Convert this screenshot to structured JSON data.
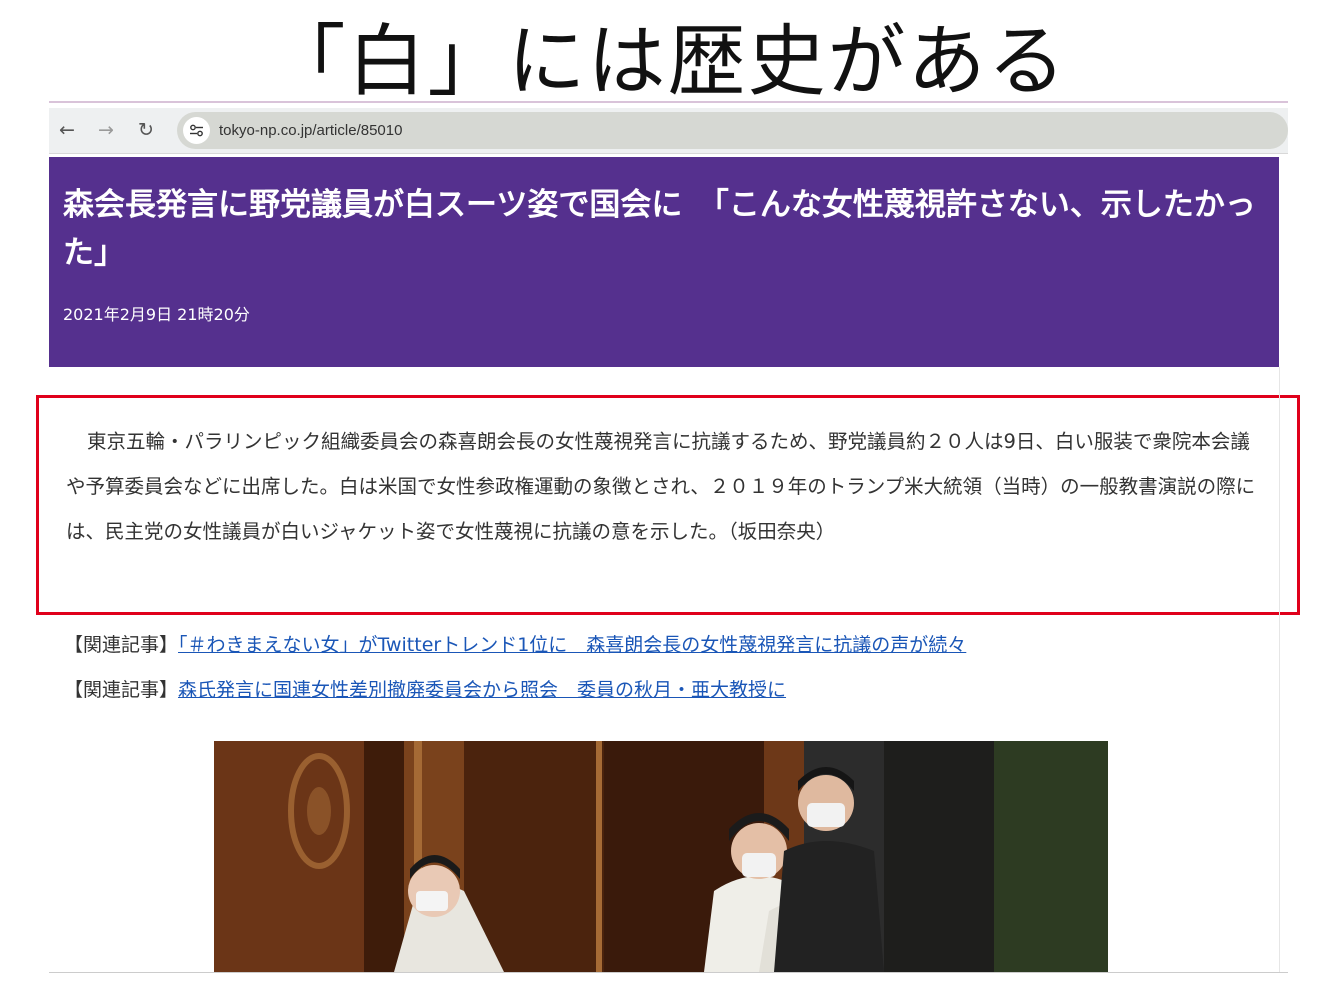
{
  "slide": {
    "title": "「白」には歴史がある"
  },
  "browser": {
    "back_icon": "←",
    "forward_icon": "→",
    "reload_icon": "↻",
    "url": "tokyo-np.co.jp/article/85010"
  },
  "article": {
    "headline": "森会長発言に野党議員が白スーツ姿で国会に　「こんな女性蔑視許さない、示したかった」",
    "date": "2021年2月9日 21時20分",
    "body": "東京五輪・パラリンピック組織委員会の森喜朗会長の女性蔑視発言に抗議するため、野党議員約２０人は9日、白い服装で衆院本会議や予算委員会などに出席した。白は米国で女性参政権運動の象徴とされ、２０１９年のトランプ米大統領（当時）の一般教書演説の際には、民主党の女性議員が白いジャケット姿で女性蔑視に抗議の意を示した。（坂田奈央）"
  },
  "related": [
    {
      "prefix": "【関連記事】",
      "link": "「＃わきまえない女」がTwitterトレンド1位に　森喜朗会長の女性蔑視発言に抗議の声が続々"
    },
    {
      "prefix": "【関連記事】",
      "link": "森氏発言に国連女性差別撤廃委員会から照会　委員の秋月・亜大教授に"
    }
  ],
  "colors": {
    "banner": "#55308e",
    "highlight_border": "#e0001b",
    "link": "#1a56b7"
  },
  "icons": {
    "site_info": "tune-icon",
    "back": "arrow-left-icon",
    "forward": "arrow-right-icon",
    "reload": "reload-icon"
  }
}
